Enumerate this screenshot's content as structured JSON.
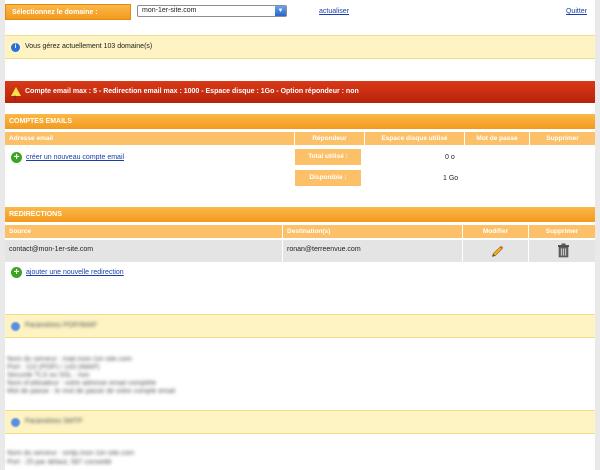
{
  "topbar": {
    "domain_label": "Sélectionnez le domaine :",
    "selected_domain": "mon-1er-site.com",
    "update_link": "actualiser",
    "quit_link": "Quitter"
  },
  "info": {
    "message": "Vous gérez actuellement 103 domaine(s)"
  },
  "alert": {
    "message": "Compte email max : 5 - Redirection email max : 1000 - Espace disque : 1Go - Option répondeur : non"
  },
  "email_accounts": {
    "title": "COMPTES EMAILS",
    "columns": [
      "Adresse email",
      "Répondeur",
      "Espace disque utilisé",
      "Mot de passe",
      "Supprimer"
    ],
    "add_link": "créer un nouveau compte email",
    "total_label": "Total utilisé :",
    "total_value": "0 o",
    "available_label": "Disponible :",
    "available_value": "1 Go"
  },
  "redirections": {
    "title": "REDIRECTIONS",
    "columns": [
      "Source",
      "Destination(s)",
      "Modifier",
      "Supprimer"
    ],
    "rows": [
      {
        "source": "contact@mon-1er-site.com",
        "destination": "ronan@terreenvue.com"
      }
    ],
    "add_link": "ajouter une nouvelle redirection"
  },
  "pop_section": {
    "title": "Paramètres POP/IMAP",
    "lines": [
      "Nom du serveur : mail.mon-1er-site.com",
      "Port : 110 (POP) / 143 (IMAP)",
      "Sécurité TLS ou SSL : non",
      "Nom d'utilisateur : votre adresse email complète",
      "Mot de passe : le mot de passe de votre compte email"
    ]
  },
  "smtp_section": {
    "title": "Paramètres SMTP",
    "lines": [
      "Nom du serveur : smtp.mon-1er-site.com",
      "Port : 25 par défaut, 587 conseillé"
    ]
  }
}
